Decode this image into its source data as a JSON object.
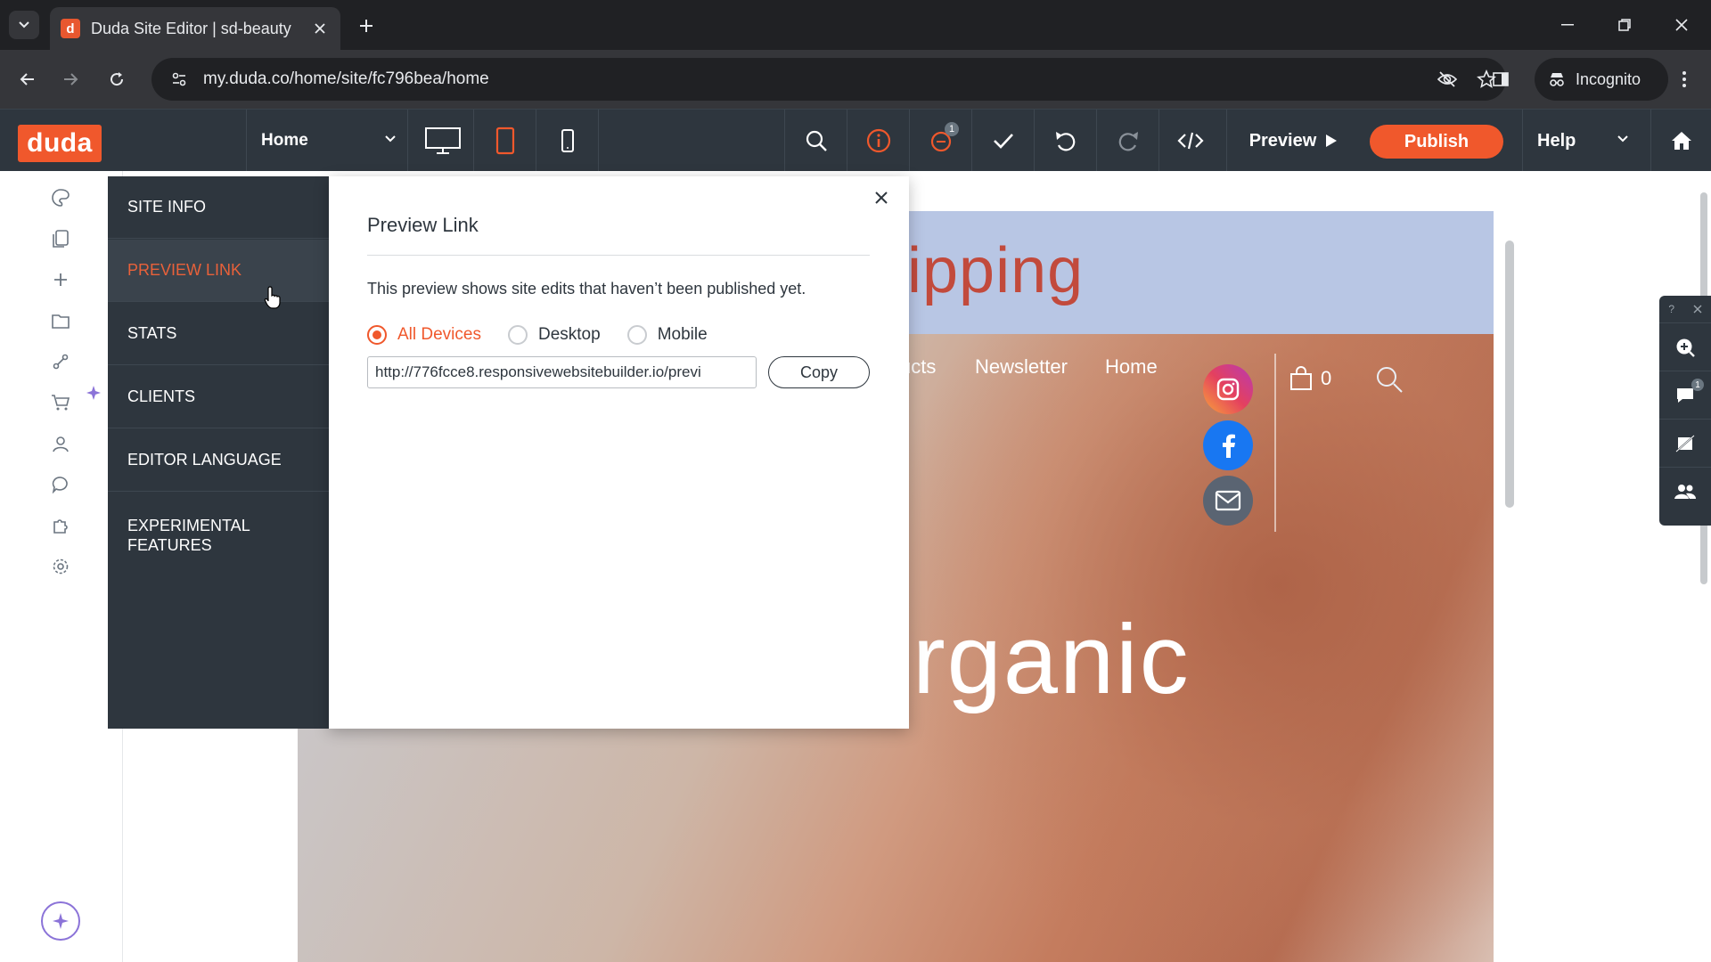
{
  "browser": {
    "tab_title": "Duda Site Editor | sd-beauty",
    "favicon_letter": "d",
    "url": "my.duda.co/home/site/fc796bea/home",
    "profile_label": "Incognito"
  },
  "editor": {
    "logo": "duda",
    "page_select": "Home",
    "preview_label": "Preview",
    "publish_label": "Publish",
    "help_label": "Help",
    "notification_count": "1",
    "accent_color": "#f0582c"
  },
  "site_info_menu": {
    "items": [
      {
        "label": "SITE INFO"
      },
      {
        "label": "PREVIEW LINK"
      },
      {
        "label": "STATS"
      },
      {
        "label": "CLIENTS"
      },
      {
        "label": "EDITOR LANGUAGE"
      },
      {
        "label": "EXPERIMENTAL FEATURES"
      }
    ],
    "active": "PREVIEW LINK"
  },
  "dialog": {
    "title": "Preview Link",
    "description": "This preview shows site edits that haven’t been published yet.",
    "radios": [
      {
        "label": "All Devices",
        "selected": true
      },
      {
        "label": "Desktop",
        "selected": false
      },
      {
        "label": "Mobile",
        "selected": false
      }
    ],
    "link_value": "http://776fcce8.responsivewebsitebuilder.io/previ",
    "copy_label": "Copy"
  },
  "site_preview": {
    "banner_text": "ipping",
    "nav": [
      "ucts",
      "Newsletter",
      "Home"
    ],
    "cart_count": "0",
    "hero_text": "rganic",
    "socials": [
      "instagram-icon",
      "facebook-icon",
      "mail-icon"
    ]
  },
  "right_tools": {
    "help_glyph": "?",
    "badge_count": "1"
  }
}
